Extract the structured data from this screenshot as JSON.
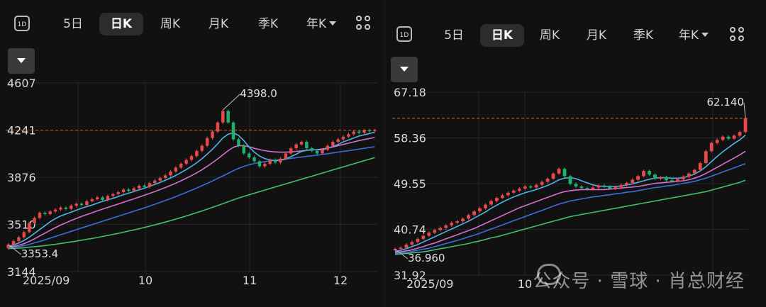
{
  "toolbar": {
    "period_icon": "1D",
    "tabs": [
      "5日",
      "日K",
      "周K",
      "月K",
      "季K",
      "年K"
    ],
    "active_tab": "日K",
    "grid_icon": "grid-icon",
    "dropdown_icon": "caret-down-icon"
  },
  "watermark": "公众号 · 雪球 · 肖总财经",
  "colors": {
    "up": "#e84a4a",
    "down": "#1db36b",
    "ma_short": "#4fb3e6",
    "ma_mid": "#d86fd0",
    "ma_long": "#3a6fd8",
    "ma_longest": "#3fbf6a",
    "price_line": "#d2691e"
  },
  "chart_data": [
    {
      "type": "candlestick",
      "y_ticks": [
        "4607",
        "4241",
        "3876",
        "3510",
        "3144"
      ],
      "ylim": [
        3144,
        4607
      ],
      "x_ticks": [
        "2025/09",
        "10",
        "11",
        "12"
      ],
      "current_price": 4241,
      "annotations": [
        {
          "label": "4398.0",
          "value": 4398.0,
          "kind": "high"
        },
        {
          "label": "3353.4",
          "value": 3353.4,
          "kind": "low"
        }
      ],
      "close": [
        3353,
        3380,
        3410,
        3450,
        3520,
        3560,
        3600,
        3590,
        3610,
        3625,
        3640,
        3630,
        3655,
        3670,
        3660,
        3690,
        3705,
        3720,
        3700,
        3730,
        3745,
        3760,
        3780,
        3770,
        3790,
        3810,
        3800,
        3830,
        3850,
        3870,
        3890,
        3920,
        3950,
        3980,
        4010,
        4040,
        4080,
        4120,
        4180,
        4230,
        4300,
        4390,
        4300,
        4170,
        4120,
        4060,
        4030,
        4000,
        3960,
        3980,
        4010,
        3990,
        4020,
        4060,
        4100,
        4130,
        4150,
        4100,
        4080,
        4060,
        4090,
        4120,
        4150,
        4170,
        4190,
        4210,
        4230,
        4220,
        4240,
        4235,
        4241
      ],
      "ma_short": [
        3340,
        3350,
        3365,
        3385,
        3410,
        3440,
        3470,
        3500,
        3530,
        3555,
        3575,
        3590,
        3605,
        3620,
        3635,
        3648,
        3660,
        3675,
        3688,
        3700,
        3712,
        3725,
        3740,
        3752,
        3765,
        3778,
        3790,
        3805,
        3820,
        3835,
        3852,
        3870,
        3890,
        3912,
        3935,
        3960,
        3988,
        4020,
        4055,
        4092,
        4135,
        4180,
        4210,
        4220,
        4200,
        4160,
        4110,
        4070,
        4040,
        4020,
        4010,
        4005,
        4008,
        4018,
        4035,
        4055,
        4075,
        4085,
        4090,
        4088,
        4090,
        4100,
        4115,
        4130,
        4150,
        4165,
        4180,
        4195,
        4205,
        4215,
        4225
      ],
      "ma_mid": [
        3335,
        3340,
        3348,
        3360,
        3378,
        3398,
        3420,
        3442,
        3464,
        3485,
        3505,
        3522,
        3540,
        3556,
        3572,
        3586,
        3600,
        3615,
        3628,
        3642,
        3655,
        3668,
        3682,
        3695,
        3708,
        3722,
        3736,
        3750,
        3765,
        3780,
        3796,
        3812,
        3830,
        3848,
        3868,
        3888,
        3910,
        3934,
        3960,
        3988,
        4018,
        4050,
        4082,
        4108,
        4120,
        4120,
        4112,
        4100,
        4090,
        4082,
        4076,
        4072,
        4070,
        4070,
        4072,
        4076,
        4080,
        4085,
        4088,
        4090,
        4095,
        4102,
        4110,
        4120,
        4130,
        4140,
        4150,
        4160,
        4168,
        4176,
        4184
      ],
      "ma_long": [
        3330,
        3333,
        3338,
        3345,
        3355,
        3366,
        3378,
        3390,
        3403,
        3416,
        3430,
        3443,
        3456,
        3469,
        3482,
        3495,
        3508,
        3521,
        3534,
        3547,
        3560,
        3573,
        3586,
        3599,
        3612,
        3625,
        3638,
        3652,
        3666,
        3680,
        3695,
        3710,
        3726,
        3742,
        3758,
        3775,
        3792,
        3810,
        3828,
        3847,
        3866,
        3886,
        3906,
        3926,
        3944,
        3960,
        3972,
        3982,
        3990,
        3996,
        4002,
        4008,
        4012,
        4017,
        4022,
        4027,
        4032,
        4037,
        4042,
        4047,
        4052,
        4058,
        4064,
        4070,
        4076,
        4082,
        4088,
        4094,
        4100,
        4106,
        4112
      ],
      "ma_longest": [
        3322,
        3324,
        3326,
        3329,
        3333,
        3337,
        3341,
        3346,
        3351,
        3356,
        3362,
        3368,
        3374,
        3380,
        3387,
        3394,
        3401,
        3408,
        3416,
        3424,
        3432,
        3440,
        3449,
        3458,
        3467,
        3476,
        3486,
        3496,
        3506,
        3517,
        3528,
        3539,
        3551,
        3563,
        3575,
        3588,
        3601,
        3614,
        3628,
        3642,
        3656,
        3671,
        3686,
        3700,
        3714,
        3727,
        3740,
        3752,
        3764,
        3776,
        3788,
        3800,
        3812,
        3824,
        3836,
        3848,
        3860,
        3872,
        3884,
        3896,
        3908,
        3920,
        3932,
        3944,
        3956,
        3968,
        3980,
        3992,
        4004,
        4016,
        4028
      ]
    },
    {
      "type": "candlestick",
      "y_ticks": [
        "67.18",
        "58.36",
        "49.55",
        "40.74",
        "31.92"
      ],
      "ylim": [
        31.92,
        67.18
      ],
      "x_ticks": [
        "2025/09",
        "10"
      ],
      "current_price": 62.14,
      "annotations": [
        {
          "label": "62.140",
          "value": 62.14,
          "kind": "high"
        },
        {
          "label": "36.960",
          "value": 36.96,
          "kind": "low"
        }
      ],
      "close": [
        36.96,
        37.2,
        37.8,
        38.3,
        38.9,
        39.5,
        40.1,
        40.6,
        41.0,
        41.5,
        42.0,
        42.3,
        42.8,
        43.5,
        44.2,
        44.8,
        45.5,
        46.2,
        46.8,
        47.3,
        47.8,
        48.2,
        48.6,
        49.0,
        48.8,
        49.3,
        49.9,
        50.5,
        51.5,
        52.4,
        51.0,
        49.5,
        49.0,
        48.7,
        48.5,
        48.8,
        49.2,
        49.0,
        48.6,
        48.9,
        49.3,
        49.7,
        50.3,
        51.0,
        52.0,
        51.3,
        50.5,
        50.8,
        50.2,
        50.0,
        50.4,
        50.9,
        51.5,
        52.2,
        53.5,
        55.8,
        57.4,
        58.0,
        58.6,
        58.2,
        58.8,
        59.5,
        62.14
      ],
      "ma_short": [
        36.5,
        36.7,
        37.0,
        37.4,
        37.8,
        38.3,
        38.8,
        39.3,
        39.8,
        40.3,
        40.8,
        41.3,
        41.8,
        42.3,
        42.9,
        43.5,
        44.1,
        44.8,
        45.4,
        46.0,
        46.5,
        47.0,
        47.4,
        47.8,
        48.1,
        48.4,
        48.8,
        49.2,
        49.7,
        50.3,
        50.6,
        50.7,
        50.5,
        50.1,
        49.7,
        49.3,
        49.1,
        49.0,
        49.0,
        49.0,
        49.1,
        49.3,
        49.5,
        49.8,
        50.1,
        50.4,
        50.6,
        50.7,
        50.7,
        50.6,
        50.6,
        50.7,
        51.0,
        51.4,
        52.0,
        52.8,
        53.8,
        54.8,
        55.7,
        56.5,
        57.3,
        58.0,
        58.9
      ],
      "ma_mid": [
        36.3,
        36.4,
        36.6,
        36.8,
        37.1,
        37.4,
        37.8,
        38.1,
        38.5,
        38.9,
        39.3,
        39.7,
        40.1,
        40.5,
        40.9,
        41.4,
        41.9,
        42.4,
        42.9,
        43.4,
        43.9,
        44.4,
        44.9,
        45.3,
        45.7,
        46.1,
        46.5,
        46.9,
        47.3,
        47.7,
        48.0,
        48.2,
        48.3,
        48.4,
        48.4,
        48.4,
        48.4,
        48.4,
        48.5,
        48.6,
        48.7,
        48.8,
        48.9,
        49.0,
        49.2,
        49.4,
        49.6,
        49.7,
        49.8,
        49.9,
        50.0,
        50.1,
        50.3,
        50.6,
        51.0,
        51.5,
        52.1,
        52.7,
        53.3,
        53.9,
        54.5,
        55.1,
        55.8
      ],
      "ma_long": [
        36.1,
        36.2,
        36.3,
        36.5,
        36.7,
        36.9,
        37.1,
        37.4,
        37.7,
        38.0,
        38.3,
        38.6,
        38.9,
        39.3,
        39.6,
        40.0,
        40.4,
        40.8,
        41.2,
        41.6,
        42.0,
        42.4,
        42.8,
        43.2,
        43.6,
        44.0,
        44.4,
        44.8,
        45.2,
        45.6,
        45.9,
        46.2,
        46.4,
        46.6,
        46.8,
        47.0,
        47.1,
        47.3,
        47.4,
        47.6,
        47.7,
        47.9,
        48.0,
        48.2,
        48.4,
        48.6,
        48.8,
        48.9,
        49.1,
        49.2,
        49.4,
        49.6,
        49.8,
        50.0,
        50.3,
        50.6,
        51.0,
        51.4,
        51.8,
        52.2,
        52.6,
        53.0,
        53.4
      ],
      "ma_longest": [
        35.9,
        36.0,
        36.1,
        36.2,
        36.3,
        36.4,
        36.6,
        36.8,
        37.0,
        37.2,
        37.4,
        37.6,
        37.8,
        38.0,
        38.3,
        38.5,
        38.8,
        39.1,
        39.3,
        39.6,
        39.9,
        40.2,
        40.5,
        40.8,
        41.1,
        41.4,
        41.7,
        42.0,
        42.3,
        42.6,
        42.9,
        43.2,
        43.4,
        43.6,
        43.8,
        44.0,
        44.2,
        44.4,
        44.6,
        44.8,
        45.0,
        45.2,
        45.4,
        45.6,
        45.8,
        46.0,
        46.2,
        46.4,
        46.6,
        46.8,
        47.0,
        47.2,
        47.4,
        47.6,
        47.8,
        48.0,
        48.3,
        48.6,
        48.9,
        49.2,
        49.5,
        49.8,
        50.2
      ]
    }
  ]
}
